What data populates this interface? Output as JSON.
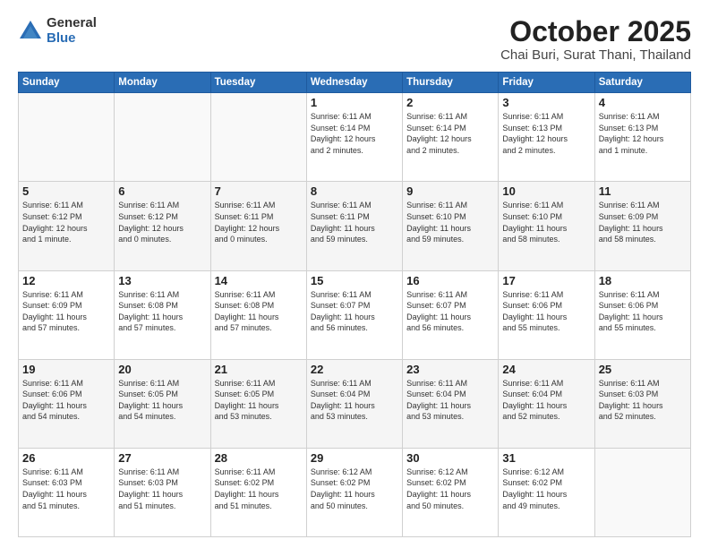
{
  "header": {
    "logo_general": "General",
    "logo_blue": "Blue",
    "month_title": "October 2025",
    "location": "Chai Buri, Surat Thani, Thailand"
  },
  "weekdays": [
    "Sunday",
    "Monday",
    "Tuesday",
    "Wednesday",
    "Thursday",
    "Friday",
    "Saturday"
  ],
  "weeks": [
    [
      {
        "day": "",
        "info": ""
      },
      {
        "day": "",
        "info": ""
      },
      {
        "day": "",
        "info": ""
      },
      {
        "day": "1",
        "info": "Sunrise: 6:11 AM\nSunset: 6:14 PM\nDaylight: 12 hours\nand 2 minutes."
      },
      {
        "day": "2",
        "info": "Sunrise: 6:11 AM\nSunset: 6:14 PM\nDaylight: 12 hours\nand 2 minutes."
      },
      {
        "day": "3",
        "info": "Sunrise: 6:11 AM\nSunset: 6:13 PM\nDaylight: 12 hours\nand 2 minutes."
      },
      {
        "day": "4",
        "info": "Sunrise: 6:11 AM\nSunset: 6:13 PM\nDaylight: 12 hours\nand 1 minute."
      }
    ],
    [
      {
        "day": "5",
        "info": "Sunrise: 6:11 AM\nSunset: 6:12 PM\nDaylight: 12 hours\nand 1 minute."
      },
      {
        "day": "6",
        "info": "Sunrise: 6:11 AM\nSunset: 6:12 PM\nDaylight: 12 hours\nand 0 minutes."
      },
      {
        "day": "7",
        "info": "Sunrise: 6:11 AM\nSunset: 6:11 PM\nDaylight: 12 hours\nand 0 minutes."
      },
      {
        "day": "8",
        "info": "Sunrise: 6:11 AM\nSunset: 6:11 PM\nDaylight: 11 hours\nand 59 minutes."
      },
      {
        "day": "9",
        "info": "Sunrise: 6:11 AM\nSunset: 6:10 PM\nDaylight: 11 hours\nand 59 minutes."
      },
      {
        "day": "10",
        "info": "Sunrise: 6:11 AM\nSunset: 6:10 PM\nDaylight: 11 hours\nand 58 minutes."
      },
      {
        "day": "11",
        "info": "Sunrise: 6:11 AM\nSunset: 6:09 PM\nDaylight: 11 hours\nand 58 minutes."
      }
    ],
    [
      {
        "day": "12",
        "info": "Sunrise: 6:11 AM\nSunset: 6:09 PM\nDaylight: 11 hours\nand 57 minutes."
      },
      {
        "day": "13",
        "info": "Sunrise: 6:11 AM\nSunset: 6:08 PM\nDaylight: 11 hours\nand 57 minutes."
      },
      {
        "day": "14",
        "info": "Sunrise: 6:11 AM\nSunset: 6:08 PM\nDaylight: 11 hours\nand 57 minutes."
      },
      {
        "day": "15",
        "info": "Sunrise: 6:11 AM\nSunset: 6:07 PM\nDaylight: 11 hours\nand 56 minutes."
      },
      {
        "day": "16",
        "info": "Sunrise: 6:11 AM\nSunset: 6:07 PM\nDaylight: 11 hours\nand 56 minutes."
      },
      {
        "day": "17",
        "info": "Sunrise: 6:11 AM\nSunset: 6:06 PM\nDaylight: 11 hours\nand 55 minutes."
      },
      {
        "day": "18",
        "info": "Sunrise: 6:11 AM\nSunset: 6:06 PM\nDaylight: 11 hours\nand 55 minutes."
      }
    ],
    [
      {
        "day": "19",
        "info": "Sunrise: 6:11 AM\nSunset: 6:06 PM\nDaylight: 11 hours\nand 54 minutes."
      },
      {
        "day": "20",
        "info": "Sunrise: 6:11 AM\nSunset: 6:05 PM\nDaylight: 11 hours\nand 54 minutes."
      },
      {
        "day": "21",
        "info": "Sunrise: 6:11 AM\nSunset: 6:05 PM\nDaylight: 11 hours\nand 53 minutes."
      },
      {
        "day": "22",
        "info": "Sunrise: 6:11 AM\nSunset: 6:04 PM\nDaylight: 11 hours\nand 53 minutes."
      },
      {
        "day": "23",
        "info": "Sunrise: 6:11 AM\nSunset: 6:04 PM\nDaylight: 11 hours\nand 53 minutes."
      },
      {
        "day": "24",
        "info": "Sunrise: 6:11 AM\nSunset: 6:04 PM\nDaylight: 11 hours\nand 52 minutes."
      },
      {
        "day": "25",
        "info": "Sunrise: 6:11 AM\nSunset: 6:03 PM\nDaylight: 11 hours\nand 52 minutes."
      }
    ],
    [
      {
        "day": "26",
        "info": "Sunrise: 6:11 AM\nSunset: 6:03 PM\nDaylight: 11 hours\nand 51 minutes."
      },
      {
        "day": "27",
        "info": "Sunrise: 6:11 AM\nSunset: 6:03 PM\nDaylight: 11 hours\nand 51 minutes."
      },
      {
        "day": "28",
        "info": "Sunrise: 6:11 AM\nSunset: 6:02 PM\nDaylight: 11 hours\nand 51 minutes."
      },
      {
        "day": "29",
        "info": "Sunrise: 6:12 AM\nSunset: 6:02 PM\nDaylight: 11 hours\nand 50 minutes."
      },
      {
        "day": "30",
        "info": "Sunrise: 6:12 AM\nSunset: 6:02 PM\nDaylight: 11 hours\nand 50 minutes."
      },
      {
        "day": "31",
        "info": "Sunrise: 6:12 AM\nSunset: 6:02 PM\nDaylight: 11 hours\nand 49 minutes."
      },
      {
        "day": "",
        "info": ""
      }
    ]
  ]
}
